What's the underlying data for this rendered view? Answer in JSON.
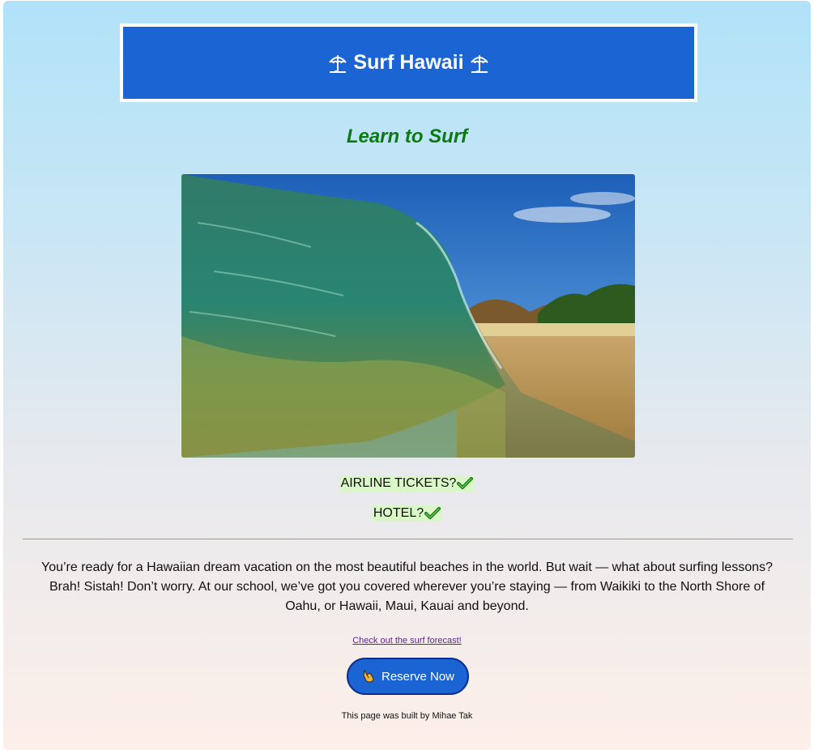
{
  "header": {
    "title": "Surf Hawaii",
    "left_icon": "beach-umbrella-icon",
    "right_icon": "beach-umbrella-icon"
  },
  "subtitle": "Learn to Surf",
  "hero_image": {
    "subject": "breaking-wave-photo"
  },
  "checklist": [
    {
      "label": "AIRLINE TICKETS?",
      "icon": "check-icon"
    },
    {
      "label": "HOTEL?",
      "icon": "check-icon"
    }
  ],
  "description": "You’re ready for a Hawaiian dream vacation on the most beautiful beaches in the world. But wait — what about surfing lessons? Brah! Sistah! Don’t worry. At our school, we’ve got you covered wherever you’re staying — from Waikiki to the North Shore of Oahu, or Hawaii, Maui, Kauai and beyond.",
  "forecast_link": "Check out the surf forecast!",
  "reserve_button": {
    "label": "Reserve Now",
    "icon": "call-me-hand-icon"
  },
  "footer": "This page was built by Mihae Tak",
  "colors": {
    "header_bg": "#1b64d3",
    "subtitle": "#0c7a13",
    "check_chip_bg": "#d9f7c7",
    "button_bg": "#1b64d3",
    "link": "#5a2a82"
  }
}
